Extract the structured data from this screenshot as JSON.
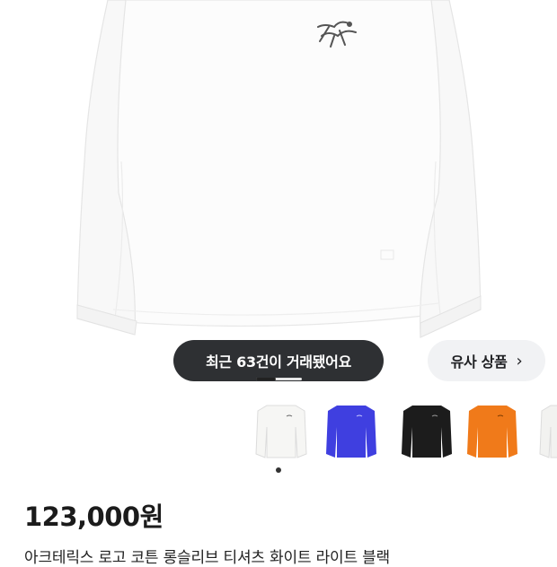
{
  "product": {
    "trade_count_text": "최근 63건이 거래됐어요",
    "similar_label": "유사 상품",
    "similar_chevron": "›",
    "price": "123,000원",
    "title_peek": "아크테릭스 로고 코튼 롱슬리브 티셔츠 화이트 라이트 블랙",
    "image_indicator": {
      "current": 1,
      "total": 2
    }
  },
  "thumbnails": [
    {
      "color_name": "white",
      "color": "#f6f6f4"
    },
    {
      "color_name": "blue",
      "color": "#3f3fe0"
    },
    {
      "color_name": "black",
      "color": "#1c1c1c"
    },
    {
      "color_name": "orange",
      "color": "#f07a1a"
    },
    {
      "color_name": "white",
      "color": "#f2f2f0"
    }
  ],
  "colors": {
    "pill_dark": "#2e3033",
    "pill_light": "#f1f2f4",
    "text_primary": "#1b1b1b"
  },
  "icons": {
    "brand_logo": "arcteryx-bird-logo",
    "chevron": "chevron-right-icon"
  }
}
